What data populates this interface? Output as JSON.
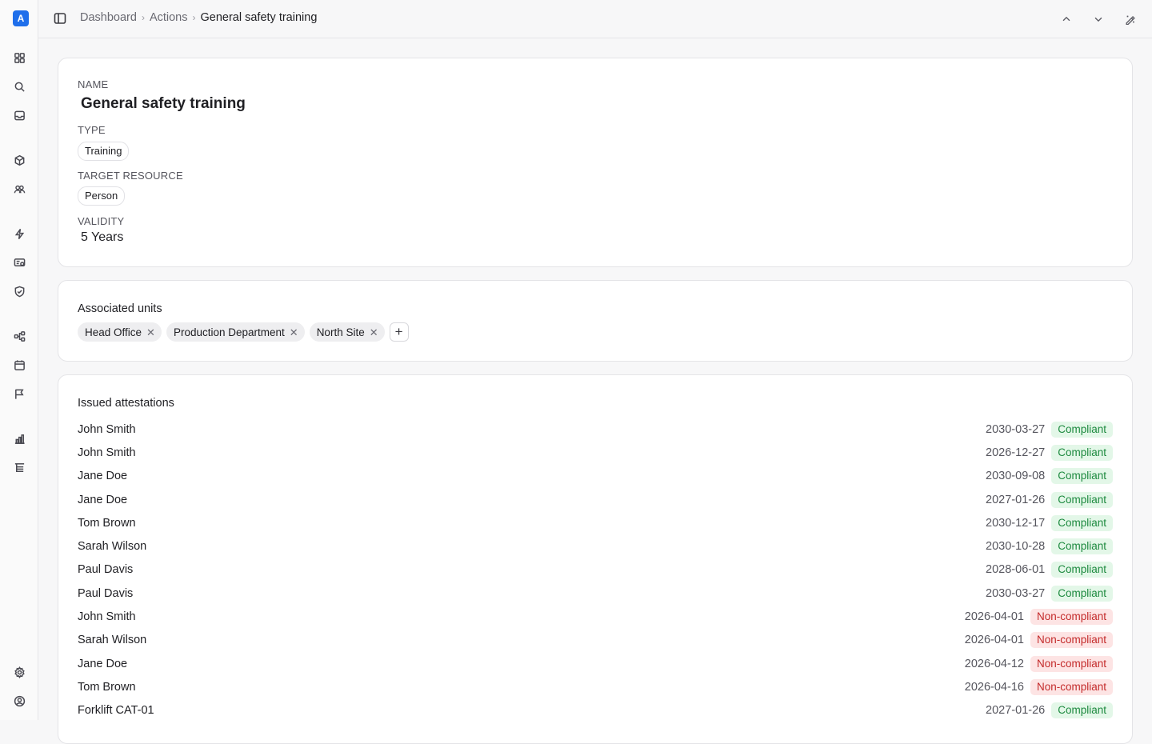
{
  "app": {
    "logo_letter": "A"
  },
  "sidebar": {
    "icons": [
      "grid-icon",
      "search-icon",
      "inbox-icon",
      "box-icon",
      "users-icon",
      "bolt-icon",
      "checklist-icon",
      "shield-check-icon",
      "workflow-icon",
      "calendar-icon",
      "flag-icon",
      "bar-chart-icon",
      "tree-icon",
      "gear-icon",
      "user-circle-icon"
    ]
  },
  "breadcrumb": {
    "items": [
      "Dashboard",
      "Actions"
    ],
    "current": "General safety training"
  },
  "details": {
    "name_label": "NAME",
    "name_value": "General safety training",
    "type_label": "TYPE",
    "type_value": "Training",
    "target_label": "TARGET RESOURCE",
    "target_value": "Person",
    "validity_label": "VALIDITY",
    "validity_value": "5 Years"
  },
  "units": {
    "title": "Associated units",
    "items": [
      "Head Office",
      "Production Department",
      "North Site"
    ]
  },
  "attestations": {
    "title": "Issued attestations",
    "rows": [
      {
        "name": "John Smith",
        "date": "2030-03-27",
        "status": "Compliant",
        "ok": true
      },
      {
        "name": "John Smith",
        "date": "2026-12-27",
        "status": "Compliant",
        "ok": true
      },
      {
        "name": "Jane Doe",
        "date": "2030-09-08",
        "status": "Compliant",
        "ok": true
      },
      {
        "name": "Jane Doe",
        "date": "2027-01-26",
        "status": "Compliant",
        "ok": true
      },
      {
        "name": "Tom Brown",
        "date": "2030-12-17",
        "status": "Compliant",
        "ok": true
      },
      {
        "name": "Sarah Wilson",
        "date": "2030-10-28",
        "status": "Compliant",
        "ok": true
      },
      {
        "name": "Paul Davis",
        "date": "2028-06-01",
        "status": "Compliant",
        "ok": true
      },
      {
        "name": "Paul Davis",
        "date": "2030-03-27",
        "status": "Compliant",
        "ok": true
      },
      {
        "name": "John Smith",
        "date": "2026-04-01",
        "status": "Non-compliant",
        "ok": false
      },
      {
        "name": "Sarah Wilson",
        "date": "2026-04-01",
        "status": "Non-compliant",
        "ok": false
      },
      {
        "name": "Jane Doe",
        "date": "2026-04-12",
        "status": "Non-compliant",
        "ok": false
      },
      {
        "name": "Tom Brown",
        "date": "2026-04-16",
        "status": "Non-compliant",
        "ok": false
      },
      {
        "name": "Forklift CAT-01",
        "date": "2027-01-26",
        "status": "Compliant",
        "ok": true
      }
    ]
  },
  "colors": {
    "accent": "#1f6feb",
    "compliant_bg": "#e3f7e8",
    "compliant_text": "#1d8a3f",
    "noncompliant_bg": "#fde4e4",
    "noncompliant_text": "#c42b2b"
  }
}
